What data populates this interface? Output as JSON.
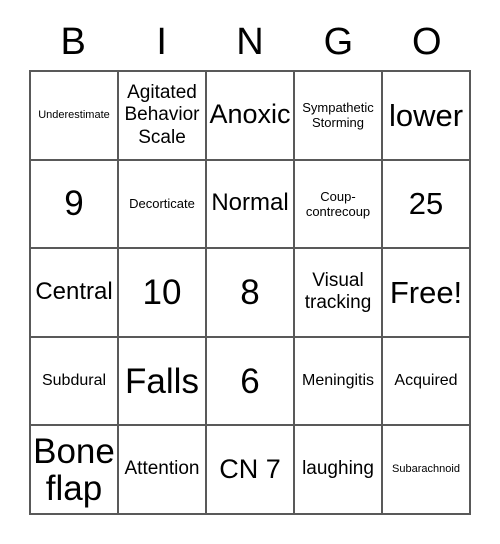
{
  "card": {
    "type": "bingo-card",
    "columns": 5,
    "rows": 5,
    "header": {
      "letters": [
        "B",
        "I",
        "N",
        "G",
        "O"
      ]
    },
    "free_space": {
      "label": "Free!",
      "row": 2,
      "column": 4
    },
    "colors": {
      "background": "#ffffff",
      "text": "#000000",
      "grid_line": "#595959"
    },
    "grid": [
      [
        {
          "text": "Underestimate",
          "size": "sz-xs"
        },
        {
          "text": "Agitated Behavior Scale",
          "size": "sz-l"
        },
        {
          "text": "Anoxic",
          "size": "sz-2xl"
        },
        {
          "text": "Sympathetic Storming",
          "size": "sz-s"
        },
        {
          "text": "lower",
          "size": "sz-3xl"
        }
      ],
      [
        {
          "text": "9",
          "size": "sz-4xl"
        },
        {
          "text": "Decorticate",
          "size": "sz-s"
        },
        {
          "text": "Normal",
          "size": "sz-xl"
        },
        {
          "text": "Coup-contrecoup",
          "size": "sz-s"
        },
        {
          "text": "25",
          "size": "sz-3xl"
        }
      ],
      [
        {
          "text": "Central",
          "size": "sz-xl"
        },
        {
          "text": "10",
          "size": "sz-4xl"
        },
        {
          "text": "8",
          "size": "sz-4xl"
        },
        {
          "text": "Visual tracking",
          "size": "sz-l"
        },
        {
          "text": "Free!",
          "size": "sz-3xl"
        }
      ],
      [
        {
          "text": "Subdural",
          "size": "sz-m"
        },
        {
          "text": "Falls",
          "size": "sz-4xl"
        },
        {
          "text": "6",
          "size": "sz-4xl"
        },
        {
          "text": "Meningitis",
          "size": "sz-m"
        },
        {
          "text": "Acquired",
          "size": "sz-m"
        }
      ],
      [
        {
          "text": "Bone flap",
          "size": "sz-4xl"
        },
        {
          "text": "Attention",
          "size": "sz-l"
        },
        {
          "text": "CN 7",
          "size": "sz-2xl"
        },
        {
          "text": "laughing",
          "size": "sz-l"
        },
        {
          "text": "Subarachnoid",
          "size": "sz-xs"
        }
      ]
    ]
  }
}
